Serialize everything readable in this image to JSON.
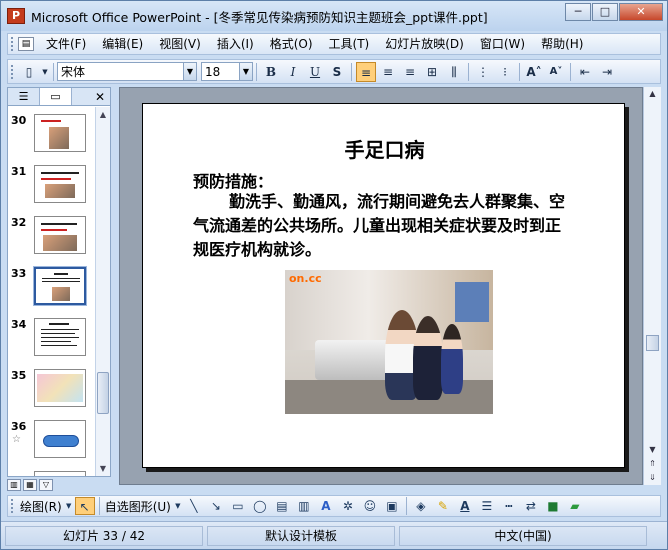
{
  "window": {
    "app_icon": "P",
    "title": "Microsoft Office PowerPoint - [冬季常见传染病预防知识主题班会_ppt课件.ppt]",
    "buttons": {
      "minimize": "─",
      "maximize": "□",
      "close": "✕"
    }
  },
  "menu": {
    "items": [
      "文件(F)",
      "编辑(E)",
      "视图(V)",
      "插入(I)",
      "格式(O)",
      "工具(T)",
      "幻灯片放映(D)",
      "窗口(W)",
      "帮助(H)"
    ]
  },
  "format_toolbar": {
    "font_name": "宋体",
    "font_size": "18",
    "bold": "B",
    "italic": "I",
    "underline": "U",
    "shadow": "S"
  },
  "slides_panel": {
    "tab_outline_icon": "outline-icon",
    "tab_slides_icon": "slides-icon",
    "close": "✕",
    "thumbnails": [
      {
        "number": "30"
      },
      {
        "number": "31"
      },
      {
        "number": "32"
      },
      {
        "number": "33",
        "selected": true
      },
      {
        "number": "34"
      },
      {
        "number": "35"
      },
      {
        "number": "36",
        "star": "☆"
      }
    ]
  },
  "slide": {
    "title": "手足口病",
    "subtitle": "预防措施：",
    "body": "勤洗手、勤通风，流行期间避免去人群聚集、空气流通差的公共场所。儿童出现相关症状要及时到正规医疗机构就诊。",
    "photo_logo": "on.cc"
  },
  "drawing_toolbar": {
    "draw_label": "绘图(R)",
    "autoshapes_label": "自选图形(U)"
  },
  "status": {
    "slide_info": "幻灯片 33 / 42",
    "design": "默认设计模板",
    "language": "中文(中国)"
  },
  "colors": {
    "titlebar": "#bcd3ee",
    "accent_active": "#ffcf7a",
    "close_button": "#c7472b"
  }
}
